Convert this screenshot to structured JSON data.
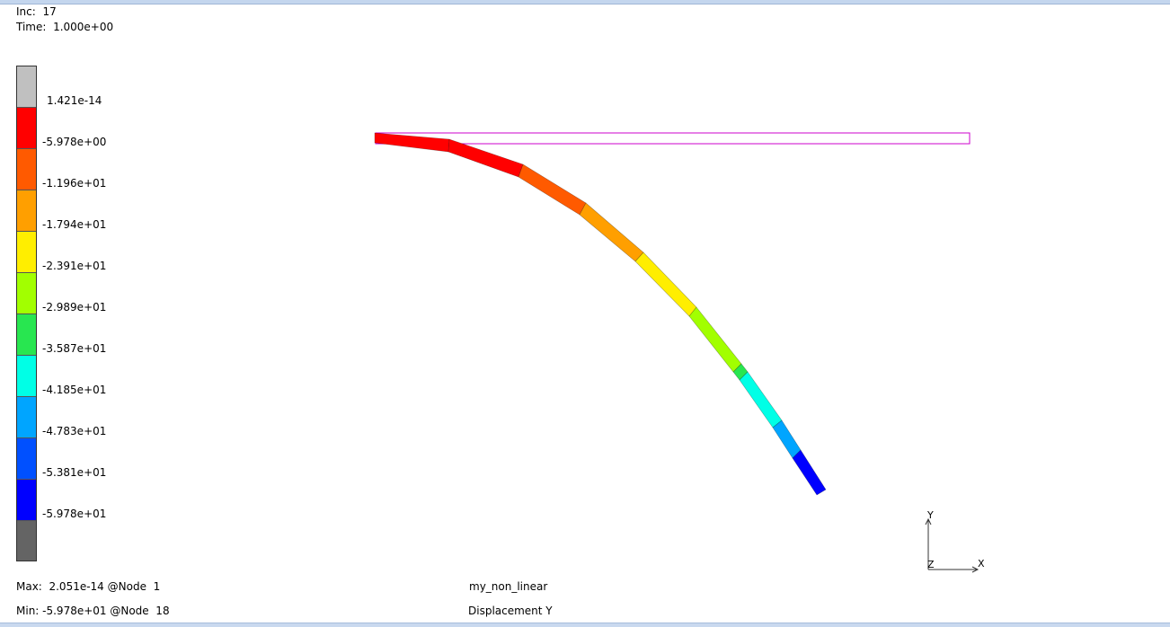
{
  "header": {
    "inc_label": "Inc:",
    "inc_value": "17",
    "time_label": "Time:",
    "time_value": "1.000e+00"
  },
  "legend": {
    "segments": [
      {
        "color": "#c0c0c0"
      },
      {
        "color": "#ff0000"
      },
      {
        "color": "#ff5a00"
      },
      {
        "color": "#ff9f00"
      },
      {
        "color": "#ffee00"
      },
      {
        "color": "#a2ff00"
      },
      {
        "color": "#28e650"
      },
      {
        "color": "#00ffe6"
      },
      {
        "color": "#00a5ff"
      },
      {
        "color": "#0050ff"
      },
      {
        "color": "#0000ff"
      },
      {
        "color": "#646464"
      }
    ],
    "labels": [
      "1.421e-14",
      "-5.978e+00",
      "-1.196e+01",
      "-1.794e+01",
      "-2.391e+01",
      "-2.989e+01",
      "-3.587e+01",
      "-4.185e+01",
      "-4.783e+01",
      "-5.381e+01",
      "-5.978e+01"
    ]
  },
  "footer": {
    "max_text": "Max:  2.051e-14 @Node  1",
    "min_text": "Min: -5.978e+01 @Node  18",
    "job_name": "my_non_linear",
    "result_name": "Displacement Y"
  },
  "triad": {
    "y_label": "Y",
    "x_label": "X",
    "z_label": "Z"
  },
  "colors": {
    "undeformed_outline": "#cc00cc"
  }
}
